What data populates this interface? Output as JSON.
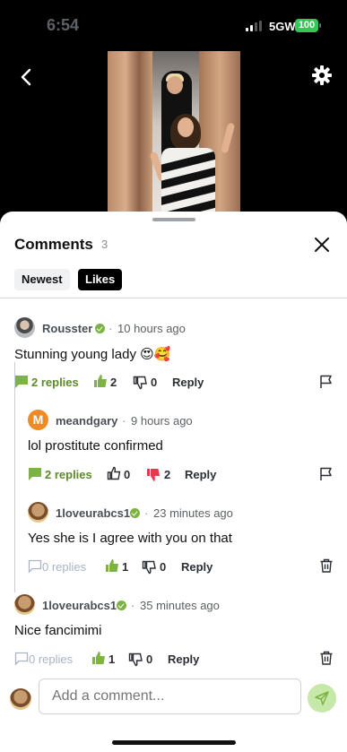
{
  "status_bar": {
    "time": "6:54",
    "network": "5GW",
    "battery": "100"
  },
  "comments_panel": {
    "title": "Comments",
    "count": "3",
    "tabs": [
      {
        "label": "Newest",
        "active": false
      },
      {
        "label": "Likes",
        "active": true
      }
    ]
  },
  "comments": [
    {
      "user": "Rousster",
      "verified": true,
      "time": "10 hours ago",
      "text": "Stunning young lady 😍🥰",
      "replies": "2 replies",
      "likes": "2",
      "dislikes": "0",
      "reply_label": "Reply"
    },
    {
      "user": "meandgary",
      "avatar_letter": "M",
      "verified": false,
      "time": "9 hours ago",
      "text": "lol prostitute confirmed",
      "replies": "2 replies",
      "likes": "0",
      "dislikes": "2",
      "reply_label": "Reply"
    },
    {
      "user": "1loveurabcs1",
      "verified": true,
      "time": "23 minutes ago",
      "text": "Yes she is I agree with you on that",
      "replies": "0 replies",
      "likes": "1",
      "dislikes": "0",
      "reply_label": "Reply"
    },
    {
      "user": "1loveurabcs1",
      "verified": true,
      "time": "35 minutes ago",
      "text": "Nice fancimimi",
      "replies": "0 replies",
      "likes": "1",
      "dislikes": "0",
      "reply_label": "Reply"
    }
  ],
  "composer": {
    "placeholder": "Add a comment..."
  },
  "colors": {
    "accent_green": "#7cb342",
    "dislike_red": "#e53950",
    "avatar_orange": "#f08a24"
  },
  "icons": [
    "back-icon",
    "gear-icon",
    "close-icon",
    "comment-icon",
    "thumbs-up-icon",
    "thumbs-down-icon",
    "flag-icon",
    "trash-icon",
    "send-icon",
    "verified-icon"
  ]
}
